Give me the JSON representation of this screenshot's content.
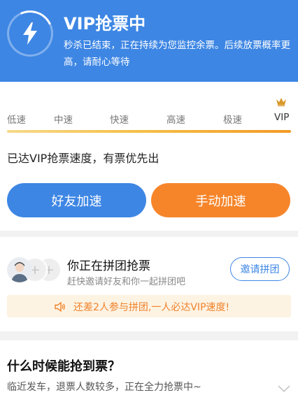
{
  "header": {
    "title": "VIP抢票中",
    "description": "秒杀已结束，正在持续为您监控余票。后续放票概率更高，请耐心等待",
    "bg_color": "#3d86e4",
    "icon": "lightning-bolt-icon"
  },
  "speed": {
    "levels": [
      "低速",
      "中速",
      "快速",
      "高速",
      "极速",
      "VIP"
    ],
    "current_level": "VIP",
    "progress": 1.0,
    "status_text": "已达VIP抢票速度，有票优先出",
    "friend_button": "好友加速",
    "manual_button": "手动加速",
    "friend_color": "#3d86e4",
    "manual_color": "#f6852a"
  },
  "group": {
    "title": "你正在拼团抢票",
    "subtitle": "赶快邀请好友和你一起拼团吧",
    "invite_button": "邀请拼团",
    "notice": "还差2人参与拼团,一人必达VIP速度!",
    "notice_color": "#f0822a"
  },
  "faq": {
    "title": "什么时候能抢到票？",
    "description": "临近发车，退票人数较多，正在全力抢票中~"
  }
}
